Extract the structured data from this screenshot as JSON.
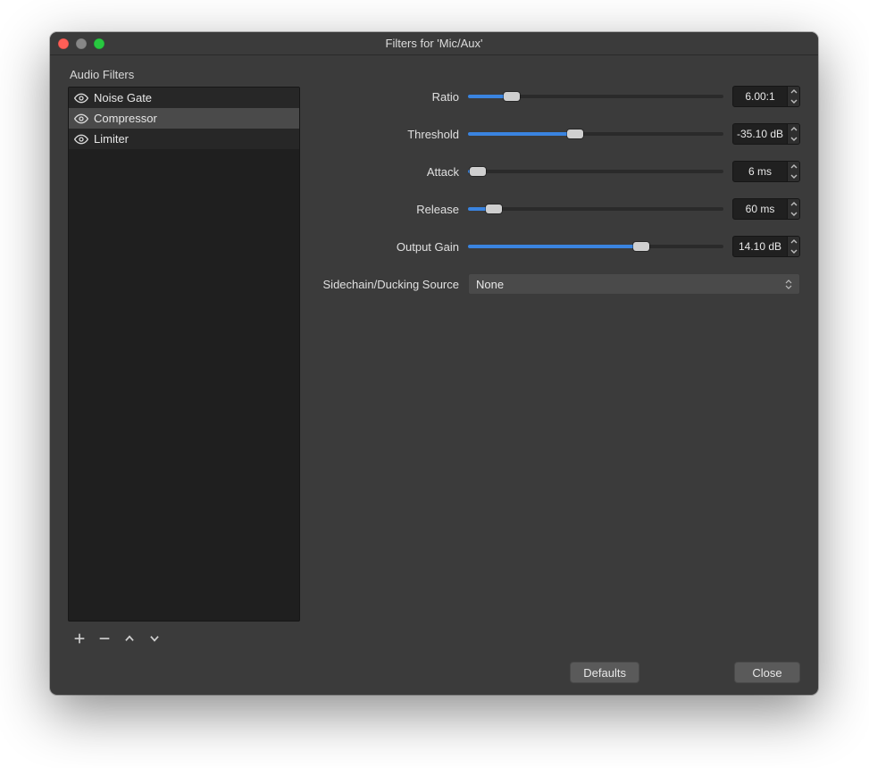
{
  "window": {
    "title": "Filters for 'Mic/Aux'"
  },
  "sidebar": {
    "label": "Audio Filters",
    "items": [
      {
        "name": "Noise Gate",
        "selected": false
      },
      {
        "name": "Compressor",
        "selected": true
      },
      {
        "name": "Limiter",
        "selected": false
      }
    ]
  },
  "props": {
    "ratio": {
      "label": "Ratio",
      "value": "6.00:1",
      "fill_pct": 17
    },
    "threshold": {
      "label": "Threshold",
      "value": "-35.10 dB",
      "fill_pct": 42
    },
    "attack": {
      "label": "Attack",
      "value": "6 ms",
      "fill_pct": 4
    },
    "release": {
      "label": "Release",
      "value": "60 ms",
      "fill_pct": 10
    },
    "outputgain": {
      "label": "Output Gain",
      "value": "14.10 dB",
      "fill_pct": 68
    },
    "sidechain": {
      "label": "Sidechain/Ducking Source",
      "value": "None"
    }
  },
  "buttons": {
    "defaults": "Defaults",
    "close": "Close"
  },
  "icons": {
    "eye": "eye-icon",
    "plus": "plus-icon",
    "minus": "minus-icon",
    "chevron_up": "chevron-up-icon",
    "chevron_down": "chevron-down-icon"
  }
}
